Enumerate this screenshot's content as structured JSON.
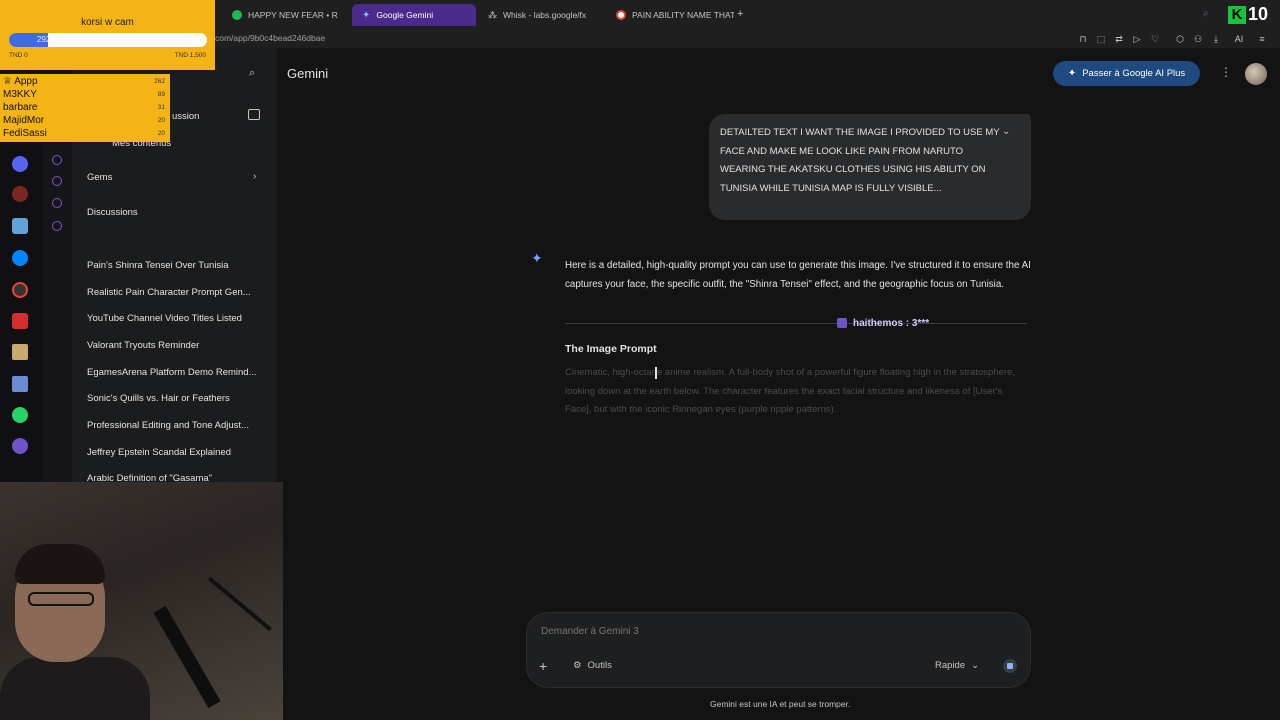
{
  "browser": {
    "tabs": [
      {
        "label": "HAPPY NEW FEAR • R",
        "color": "#1db954"
      },
      {
        "label": "Google Gemini",
        "color": "#8ab4f8"
      },
      {
        "label": "Whisk - labs.google/fx",
        "color": "#c4c4c4"
      },
      {
        "label": "PAIN ABILITY NAME THAT",
        "color": "#ea4335"
      }
    ],
    "url": "com/app/9b0c4bead246dbae"
  },
  "sidebar": {
    "partial_item": "ussion",
    "my_content": "Mes contenus",
    "gems_label": "Gems",
    "discussions_label": "Discussions",
    "chats": [
      "Pain's Shinra Tensei Over Tunisia",
      "Realistic Pain Character Prompt Gen...",
      "YouTube Channel Video Titles Listed",
      "Valorant Tryouts Reminder",
      "EgamesArena Platform Demo Remind...",
      "Sonic's Quills vs. Hair or Feathers",
      "Professional Editing and Tone Adjust...",
      "Jeffrey Epstein Scandal Explained",
      "Arabic Definition of \"Gasama\""
    ]
  },
  "header": {
    "brand": "Gemini",
    "upgrade_label": "Passer à Google AI Plus"
  },
  "conversation": {
    "user_message": "DETAILTED TEXT I WANT THE IMAGE I PROVIDED TO USE MY FACE AND MAKE ME LOOK LIKE PAIN FROM NARUTO WEARING THE AKATSKU CLOTHES USING HIS ABILITY ON TUNISIA WHILE TUNISIA MAP IS FULLY VISIBLE...",
    "answer_intro": "Here is a detailed, high-quality prompt you can use to generate this image. I've structured it to ensure the AI captures your face, the specific outfit, the \"Shinra Tensei\" effect, and the geographic focus on Tunisia.",
    "section_heading": "The Image Prompt",
    "prompt_body": "Cinematic, high-octane anime realism. A full-body shot of a powerful figure floating high in the stratosphere, looking down at the earth below. The character features the exact facial structure and likeness of [User's Face], but with the iconic Rinnegan eyes (purple ripple patterns)."
  },
  "composer": {
    "placeholder": "Demander à Gemini 3",
    "tools_label": "Outils",
    "mode_label": "Rapide"
  },
  "disclaimer": "Gemini est une IA et peut se tromper.",
  "stream": {
    "goal_title": "korsi w cam",
    "goal_value": "292",
    "goal_min": "TND 0",
    "goal_max": "TND 1,500",
    "goal_progress": 0.195,
    "leaderboard": [
      {
        "name": "Appp",
        "score": "262"
      },
      {
        "name": "M3KKY",
        "score": "89"
      },
      {
        "name": "barbare",
        "score": "31"
      },
      {
        "name": "MajidMor",
        "score": "20"
      },
      {
        "name": "FediSassi",
        "score": "20"
      }
    ],
    "alert": "haithemos : 3***",
    "counter_letter": "K",
    "counter_value": "10"
  }
}
